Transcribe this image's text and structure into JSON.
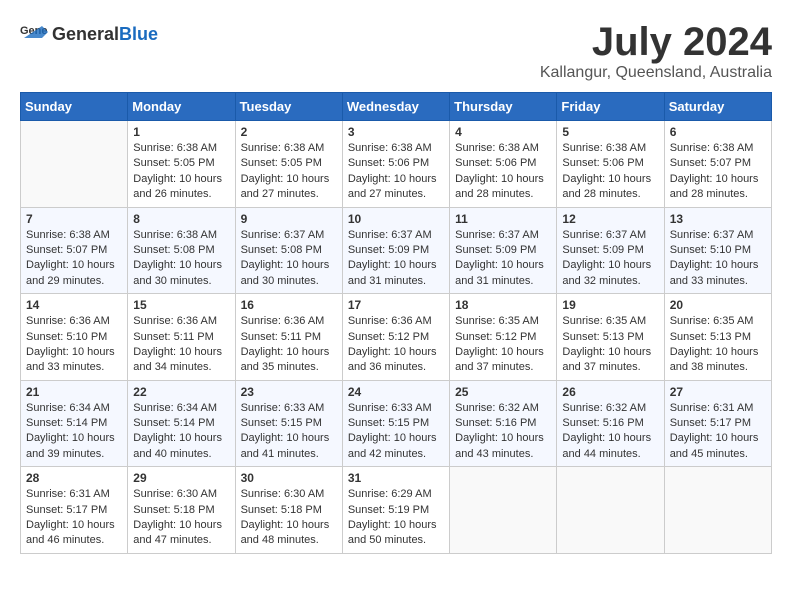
{
  "header": {
    "logo": {
      "general": "General",
      "blue": "Blue"
    },
    "title": "July 2024",
    "subtitle": "Kallangur, Queensland, Australia"
  },
  "columns": [
    "Sunday",
    "Monday",
    "Tuesday",
    "Wednesday",
    "Thursday",
    "Friday",
    "Saturday"
  ],
  "weeks": [
    [
      {
        "day": "",
        "sunrise": "",
        "sunset": "",
        "daylight": ""
      },
      {
        "day": "1",
        "sunrise": "Sunrise: 6:38 AM",
        "sunset": "Sunset: 5:05 PM",
        "daylight": "Daylight: 10 hours and 26 minutes."
      },
      {
        "day": "2",
        "sunrise": "Sunrise: 6:38 AM",
        "sunset": "Sunset: 5:05 PM",
        "daylight": "Daylight: 10 hours and 27 minutes."
      },
      {
        "day": "3",
        "sunrise": "Sunrise: 6:38 AM",
        "sunset": "Sunset: 5:06 PM",
        "daylight": "Daylight: 10 hours and 27 minutes."
      },
      {
        "day": "4",
        "sunrise": "Sunrise: 6:38 AM",
        "sunset": "Sunset: 5:06 PM",
        "daylight": "Daylight: 10 hours and 28 minutes."
      },
      {
        "day": "5",
        "sunrise": "Sunrise: 6:38 AM",
        "sunset": "Sunset: 5:06 PM",
        "daylight": "Daylight: 10 hours and 28 minutes."
      },
      {
        "day": "6",
        "sunrise": "Sunrise: 6:38 AM",
        "sunset": "Sunset: 5:07 PM",
        "daylight": "Daylight: 10 hours and 28 minutes."
      }
    ],
    [
      {
        "day": "7",
        "sunrise": "Sunrise: 6:38 AM",
        "sunset": "Sunset: 5:07 PM",
        "daylight": "Daylight: 10 hours and 29 minutes."
      },
      {
        "day": "8",
        "sunrise": "Sunrise: 6:38 AM",
        "sunset": "Sunset: 5:08 PM",
        "daylight": "Daylight: 10 hours and 30 minutes."
      },
      {
        "day": "9",
        "sunrise": "Sunrise: 6:37 AM",
        "sunset": "Sunset: 5:08 PM",
        "daylight": "Daylight: 10 hours and 30 minutes."
      },
      {
        "day": "10",
        "sunrise": "Sunrise: 6:37 AM",
        "sunset": "Sunset: 5:09 PM",
        "daylight": "Daylight: 10 hours and 31 minutes."
      },
      {
        "day": "11",
        "sunrise": "Sunrise: 6:37 AM",
        "sunset": "Sunset: 5:09 PM",
        "daylight": "Daylight: 10 hours and 31 minutes."
      },
      {
        "day": "12",
        "sunrise": "Sunrise: 6:37 AM",
        "sunset": "Sunset: 5:09 PM",
        "daylight": "Daylight: 10 hours and 32 minutes."
      },
      {
        "day": "13",
        "sunrise": "Sunrise: 6:37 AM",
        "sunset": "Sunset: 5:10 PM",
        "daylight": "Daylight: 10 hours and 33 minutes."
      }
    ],
    [
      {
        "day": "14",
        "sunrise": "Sunrise: 6:36 AM",
        "sunset": "Sunset: 5:10 PM",
        "daylight": "Daylight: 10 hours and 33 minutes."
      },
      {
        "day": "15",
        "sunrise": "Sunrise: 6:36 AM",
        "sunset": "Sunset: 5:11 PM",
        "daylight": "Daylight: 10 hours and 34 minutes."
      },
      {
        "day": "16",
        "sunrise": "Sunrise: 6:36 AM",
        "sunset": "Sunset: 5:11 PM",
        "daylight": "Daylight: 10 hours and 35 minutes."
      },
      {
        "day": "17",
        "sunrise": "Sunrise: 6:36 AM",
        "sunset": "Sunset: 5:12 PM",
        "daylight": "Daylight: 10 hours and 36 minutes."
      },
      {
        "day": "18",
        "sunrise": "Sunrise: 6:35 AM",
        "sunset": "Sunset: 5:12 PM",
        "daylight": "Daylight: 10 hours and 37 minutes."
      },
      {
        "day": "19",
        "sunrise": "Sunrise: 6:35 AM",
        "sunset": "Sunset: 5:13 PM",
        "daylight": "Daylight: 10 hours and 37 minutes."
      },
      {
        "day": "20",
        "sunrise": "Sunrise: 6:35 AM",
        "sunset": "Sunset: 5:13 PM",
        "daylight": "Daylight: 10 hours and 38 minutes."
      }
    ],
    [
      {
        "day": "21",
        "sunrise": "Sunrise: 6:34 AM",
        "sunset": "Sunset: 5:14 PM",
        "daylight": "Daylight: 10 hours and 39 minutes."
      },
      {
        "day": "22",
        "sunrise": "Sunrise: 6:34 AM",
        "sunset": "Sunset: 5:14 PM",
        "daylight": "Daylight: 10 hours and 40 minutes."
      },
      {
        "day": "23",
        "sunrise": "Sunrise: 6:33 AM",
        "sunset": "Sunset: 5:15 PM",
        "daylight": "Daylight: 10 hours and 41 minutes."
      },
      {
        "day": "24",
        "sunrise": "Sunrise: 6:33 AM",
        "sunset": "Sunset: 5:15 PM",
        "daylight": "Daylight: 10 hours and 42 minutes."
      },
      {
        "day": "25",
        "sunrise": "Sunrise: 6:32 AM",
        "sunset": "Sunset: 5:16 PM",
        "daylight": "Daylight: 10 hours and 43 minutes."
      },
      {
        "day": "26",
        "sunrise": "Sunrise: 6:32 AM",
        "sunset": "Sunset: 5:16 PM",
        "daylight": "Daylight: 10 hours and 44 minutes."
      },
      {
        "day": "27",
        "sunrise": "Sunrise: 6:31 AM",
        "sunset": "Sunset: 5:17 PM",
        "daylight": "Daylight: 10 hours and 45 minutes."
      }
    ],
    [
      {
        "day": "28",
        "sunrise": "Sunrise: 6:31 AM",
        "sunset": "Sunset: 5:17 PM",
        "daylight": "Daylight: 10 hours and 46 minutes."
      },
      {
        "day": "29",
        "sunrise": "Sunrise: 6:30 AM",
        "sunset": "Sunset: 5:18 PM",
        "daylight": "Daylight: 10 hours and 47 minutes."
      },
      {
        "day": "30",
        "sunrise": "Sunrise: 6:30 AM",
        "sunset": "Sunset: 5:18 PM",
        "daylight": "Daylight: 10 hours and 48 minutes."
      },
      {
        "day": "31",
        "sunrise": "Sunrise: 6:29 AM",
        "sunset": "Sunset: 5:19 PM",
        "daylight": "Daylight: 10 hours and 50 minutes."
      },
      {
        "day": "",
        "sunrise": "",
        "sunset": "",
        "daylight": ""
      },
      {
        "day": "",
        "sunrise": "",
        "sunset": "",
        "daylight": ""
      },
      {
        "day": "",
        "sunrise": "",
        "sunset": "",
        "daylight": ""
      }
    ]
  ]
}
